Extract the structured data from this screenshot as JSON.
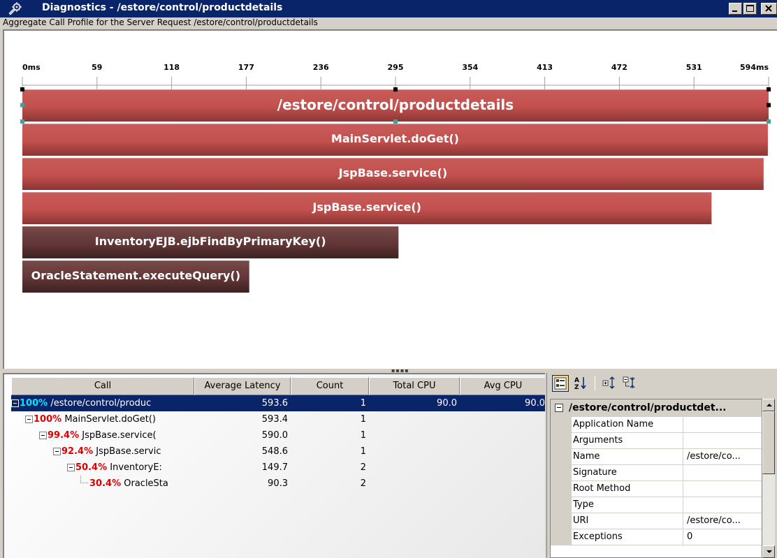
{
  "window": {
    "title": "Diagnostics - /estore/control/productdetails",
    "subtitle": "Aggregate Call Profile for the Server Request /estore/control/productdetails"
  },
  "chart_data": {
    "type": "bar",
    "axis": {
      "ticks": [
        "0ms",
        "59",
        "118",
        "177",
        "236",
        "295",
        "354",
        "413",
        "472",
        "531",
        "594ms"
      ],
      "min": 0,
      "max": 594
    },
    "bars": [
      {
        "label": "/estore/control/productdetails",
        "start": 0,
        "end": 594,
        "color": "#c85a58",
        "selected": true
      },
      {
        "label": "MainServlet.doGet()",
        "start": 0,
        "end": 593.4,
        "color": "#c85a58"
      },
      {
        "label": "JspBase.service()",
        "start": 0,
        "end": 590.0,
        "color": "#c85a58"
      },
      {
        "label": "JspBase.service()",
        "start": 0,
        "end": 548.6,
        "color": "#c85a58"
      },
      {
        "label": "InventoryEJB.ejbFindByPrimaryKey()",
        "start": 0,
        "end": 299.4,
        "color": "#6b3a3a"
      },
      {
        "label": "OracleStatement.executeQuery()",
        "start": 0,
        "end": 180.6,
        "color": "#6b3a3a"
      }
    ]
  },
  "table": {
    "columns": [
      "Call",
      "Average Latency",
      "Count",
      "Total CPU",
      "Avg CPU"
    ],
    "rows": [
      {
        "pct": "100%",
        "name": "/estore/control/produc",
        "latency": "593.6",
        "count": "1",
        "total_cpu": "90.0",
        "avg_cpu": "90.0"
      },
      {
        "pct": "100%",
        "name": "MainServlet.doGet()",
        "latency": "593.4",
        "count": "1",
        "total_cpu": "",
        "avg_cpu": ""
      },
      {
        "pct": "99.4%",
        "name": "JspBase.service(",
        "latency": "590.0",
        "count": "1",
        "total_cpu": "",
        "avg_cpu": ""
      },
      {
        "pct": "92.4%",
        "name": "JspBase.servic",
        "latency": "548.6",
        "count": "1",
        "total_cpu": "",
        "avg_cpu": ""
      },
      {
        "pct": "50.4%",
        "name": "InventoryE:",
        "latency": "149.7",
        "count": "2",
        "total_cpu": "",
        "avg_cpu": ""
      },
      {
        "pct": "30.4%",
        "name": "OracleSta",
        "latency": "90.3",
        "count": "2",
        "total_cpu": "",
        "avg_cpu": ""
      }
    ]
  },
  "properties": {
    "header": "/estore/control/productdet...",
    "rows": [
      {
        "name": "Application Name",
        "value": ""
      },
      {
        "name": "Arguments",
        "value": ""
      },
      {
        "name": "Name",
        "value": "/estore/co..."
      },
      {
        "name": "Signature",
        "value": ""
      },
      {
        "name": "Root Method",
        "value": ""
      },
      {
        "name": "Type",
        "value": ""
      },
      {
        "name": "URI",
        "value": "/estore/co..."
      },
      {
        "name": "Exceptions",
        "value": "0"
      }
    ]
  },
  "icons": {
    "app": "wrench-gear-icon",
    "categorized": "categorized-view-icon",
    "alphabetical": "sort-az-icon",
    "expand": "expand-all-icon",
    "collapse": "collapse-all-icon"
  }
}
